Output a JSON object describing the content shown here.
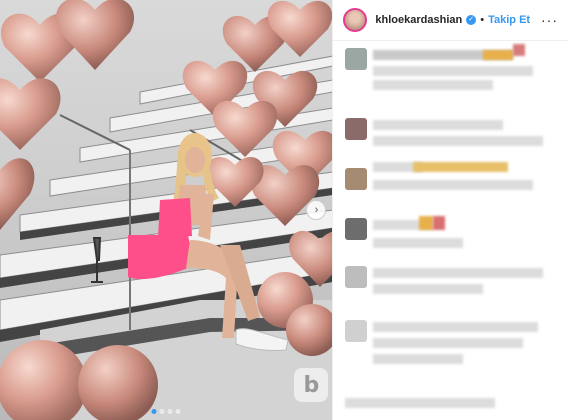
{
  "header": {
    "username": "khloekardashian",
    "verified_icon": "check-badge-icon",
    "separator": "•",
    "follow_label": "Takip Et",
    "more_icon": "more-dots-icon",
    "more_label": "···"
  },
  "media": {
    "next_icon": "chevron-right-icon",
    "next_label": "›",
    "watermark_label": "b",
    "slides_count": 4
  },
  "colors": {
    "accent": "#3897f0",
    "balloon": "#d89a8c",
    "outfit": "#ff4f8b"
  }
}
